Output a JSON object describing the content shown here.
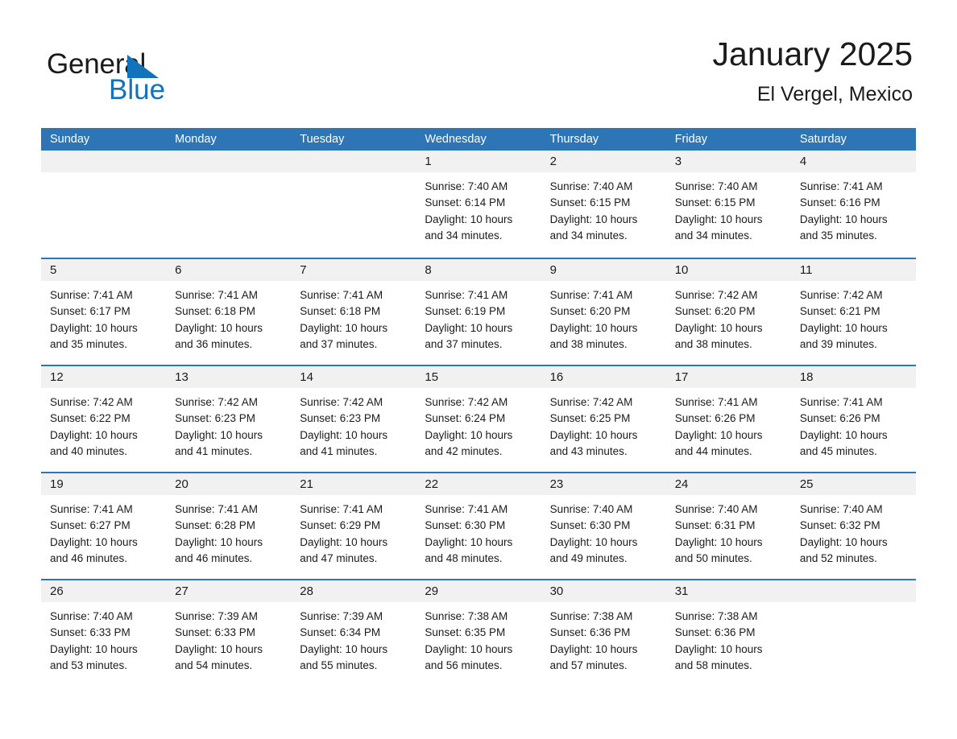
{
  "brand": {
    "word1": "General",
    "word2": "Blue",
    "accent_color": "#1272bc"
  },
  "header": {
    "title": "January 2025",
    "location": "El Vergel, Mexico"
  },
  "calendar": {
    "header_bg": "#2e75b6",
    "daynum_bg": "#f1f1f1",
    "weekday_names": [
      "Sunday",
      "Monday",
      "Tuesday",
      "Wednesday",
      "Thursday",
      "Friday",
      "Saturday"
    ],
    "weeks": [
      [
        {
          "day": "",
          "sunrise": "",
          "sunset": "",
          "daylight1": "",
          "daylight2": ""
        },
        {
          "day": "",
          "sunrise": "",
          "sunset": "",
          "daylight1": "",
          "daylight2": ""
        },
        {
          "day": "",
          "sunrise": "",
          "sunset": "",
          "daylight1": "",
          "daylight2": ""
        },
        {
          "day": "1",
          "sunrise": "Sunrise: 7:40 AM",
          "sunset": "Sunset: 6:14 PM",
          "daylight1": "Daylight: 10 hours",
          "daylight2": "and 34 minutes."
        },
        {
          "day": "2",
          "sunrise": "Sunrise: 7:40 AM",
          "sunset": "Sunset: 6:15 PM",
          "daylight1": "Daylight: 10 hours",
          "daylight2": "and 34 minutes."
        },
        {
          "day": "3",
          "sunrise": "Sunrise: 7:40 AM",
          "sunset": "Sunset: 6:15 PM",
          "daylight1": "Daylight: 10 hours",
          "daylight2": "and 34 minutes."
        },
        {
          "day": "4",
          "sunrise": "Sunrise: 7:41 AM",
          "sunset": "Sunset: 6:16 PM",
          "daylight1": "Daylight: 10 hours",
          "daylight2": "and 35 minutes."
        }
      ],
      [
        {
          "day": "5",
          "sunrise": "Sunrise: 7:41 AM",
          "sunset": "Sunset: 6:17 PM",
          "daylight1": "Daylight: 10 hours",
          "daylight2": "and 35 minutes."
        },
        {
          "day": "6",
          "sunrise": "Sunrise: 7:41 AM",
          "sunset": "Sunset: 6:18 PM",
          "daylight1": "Daylight: 10 hours",
          "daylight2": "and 36 minutes."
        },
        {
          "day": "7",
          "sunrise": "Sunrise: 7:41 AM",
          "sunset": "Sunset: 6:18 PM",
          "daylight1": "Daylight: 10 hours",
          "daylight2": "and 37 minutes."
        },
        {
          "day": "8",
          "sunrise": "Sunrise: 7:41 AM",
          "sunset": "Sunset: 6:19 PM",
          "daylight1": "Daylight: 10 hours",
          "daylight2": "and 37 minutes."
        },
        {
          "day": "9",
          "sunrise": "Sunrise: 7:41 AM",
          "sunset": "Sunset: 6:20 PM",
          "daylight1": "Daylight: 10 hours",
          "daylight2": "and 38 minutes."
        },
        {
          "day": "10",
          "sunrise": "Sunrise: 7:42 AM",
          "sunset": "Sunset: 6:20 PM",
          "daylight1": "Daylight: 10 hours",
          "daylight2": "and 38 minutes."
        },
        {
          "day": "11",
          "sunrise": "Sunrise: 7:42 AM",
          "sunset": "Sunset: 6:21 PM",
          "daylight1": "Daylight: 10 hours",
          "daylight2": "and 39 minutes."
        }
      ],
      [
        {
          "day": "12",
          "sunrise": "Sunrise: 7:42 AM",
          "sunset": "Sunset: 6:22 PM",
          "daylight1": "Daylight: 10 hours",
          "daylight2": "and 40 minutes."
        },
        {
          "day": "13",
          "sunrise": "Sunrise: 7:42 AM",
          "sunset": "Sunset: 6:23 PM",
          "daylight1": "Daylight: 10 hours",
          "daylight2": "and 41 minutes."
        },
        {
          "day": "14",
          "sunrise": "Sunrise: 7:42 AM",
          "sunset": "Sunset: 6:23 PM",
          "daylight1": "Daylight: 10 hours",
          "daylight2": "and 41 minutes."
        },
        {
          "day": "15",
          "sunrise": "Sunrise: 7:42 AM",
          "sunset": "Sunset: 6:24 PM",
          "daylight1": "Daylight: 10 hours",
          "daylight2": "and 42 minutes."
        },
        {
          "day": "16",
          "sunrise": "Sunrise: 7:42 AM",
          "sunset": "Sunset: 6:25 PM",
          "daylight1": "Daylight: 10 hours",
          "daylight2": "and 43 minutes."
        },
        {
          "day": "17",
          "sunrise": "Sunrise: 7:41 AM",
          "sunset": "Sunset: 6:26 PM",
          "daylight1": "Daylight: 10 hours",
          "daylight2": "and 44 minutes."
        },
        {
          "day": "18",
          "sunrise": "Sunrise: 7:41 AM",
          "sunset": "Sunset: 6:26 PM",
          "daylight1": "Daylight: 10 hours",
          "daylight2": "and 45 minutes."
        }
      ],
      [
        {
          "day": "19",
          "sunrise": "Sunrise: 7:41 AM",
          "sunset": "Sunset: 6:27 PM",
          "daylight1": "Daylight: 10 hours",
          "daylight2": "and 46 minutes."
        },
        {
          "day": "20",
          "sunrise": "Sunrise: 7:41 AM",
          "sunset": "Sunset: 6:28 PM",
          "daylight1": "Daylight: 10 hours",
          "daylight2": "and 46 minutes."
        },
        {
          "day": "21",
          "sunrise": "Sunrise: 7:41 AM",
          "sunset": "Sunset: 6:29 PM",
          "daylight1": "Daylight: 10 hours",
          "daylight2": "and 47 minutes."
        },
        {
          "day": "22",
          "sunrise": "Sunrise: 7:41 AM",
          "sunset": "Sunset: 6:30 PM",
          "daylight1": "Daylight: 10 hours",
          "daylight2": "and 48 minutes."
        },
        {
          "day": "23",
          "sunrise": "Sunrise: 7:40 AM",
          "sunset": "Sunset: 6:30 PM",
          "daylight1": "Daylight: 10 hours",
          "daylight2": "and 49 minutes."
        },
        {
          "day": "24",
          "sunrise": "Sunrise: 7:40 AM",
          "sunset": "Sunset: 6:31 PM",
          "daylight1": "Daylight: 10 hours",
          "daylight2": "and 50 minutes."
        },
        {
          "day": "25",
          "sunrise": "Sunrise: 7:40 AM",
          "sunset": "Sunset: 6:32 PM",
          "daylight1": "Daylight: 10 hours",
          "daylight2": "and 52 minutes."
        }
      ],
      [
        {
          "day": "26",
          "sunrise": "Sunrise: 7:40 AM",
          "sunset": "Sunset: 6:33 PM",
          "daylight1": "Daylight: 10 hours",
          "daylight2": "and 53 minutes."
        },
        {
          "day": "27",
          "sunrise": "Sunrise: 7:39 AM",
          "sunset": "Sunset: 6:33 PM",
          "daylight1": "Daylight: 10 hours",
          "daylight2": "and 54 minutes."
        },
        {
          "day": "28",
          "sunrise": "Sunrise: 7:39 AM",
          "sunset": "Sunset: 6:34 PM",
          "daylight1": "Daylight: 10 hours",
          "daylight2": "and 55 minutes."
        },
        {
          "day": "29",
          "sunrise": "Sunrise: 7:38 AM",
          "sunset": "Sunset: 6:35 PM",
          "daylight1": "Daylight: 10 hours",
          "daylight2": "and 56 minutes."
        },
        {
          "day": "30",
          "sunrise": "Sunrise: 7:38 AM",
          "sunset": "Sunset: 6:36 PM",
          "daylight1": "Daylight: 10 hours",
          "daylight2": "and 57 minutes."
        },
        {
          "day": "31",
          "sunrise": "Sunrise: 7:38 AM",
          "sunset": "Sunset: 6:36 PM",
          "daylight1": "Daylight: 10 hours",
          "daylight2": "and 58 minutes."
        },
        {
          "day": "",
          "sunrise": "",
          "sunset": "",
          "daylight1": "",
          "daylight2": ""
        }
      ]
    ]
  }
}
